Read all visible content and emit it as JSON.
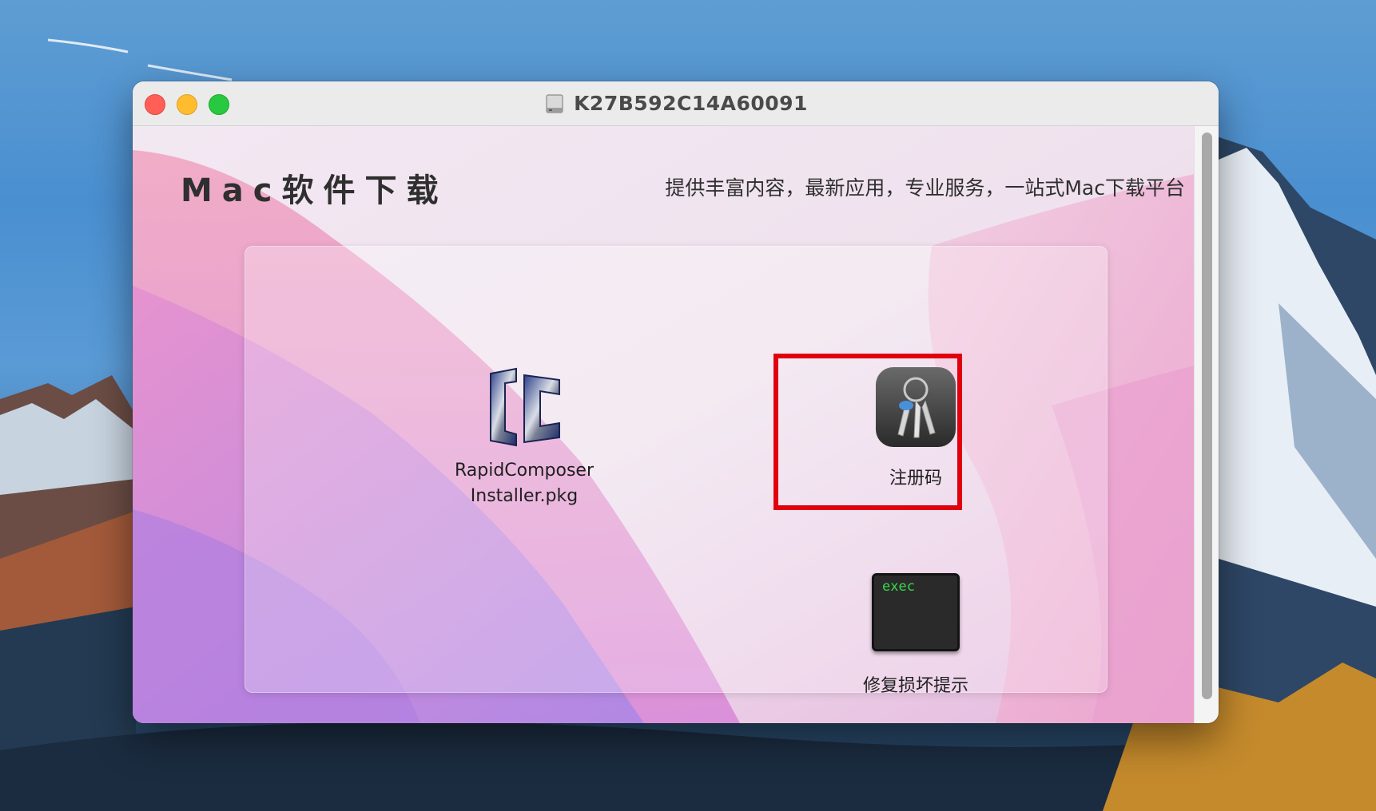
{
  "window": {
    "title": "K27B592C14A60091",
    "title_icon": "disk-image-icon"
  },
  "banner": {
    "heading": "Mac软件下载",
    "tagline": "提供丰富内容，最新应用，专业服务，一站式Mac下载平台"
  },
  "items": {
    "installer": {
      "label_line1": "RapidComposer",
      "label_line2": "Installer.pkg",
      "icon": "rapidcomposer-app-icon"
    },
    "keychain": {
      "label": "注册码",
      "icon": "keychain-icon"
    },
    "exec": {
      "label": "修复损坏提示",
      "icon": "terminal-exec-icon",
      "icon_text": "exec"
    }
  },
  "colors": {
    "highlight": "#e0000e",
    "close": "#ff5f57",
    "minimize": "#febc2e",
    "maximize": "#28c840"
  }
}
